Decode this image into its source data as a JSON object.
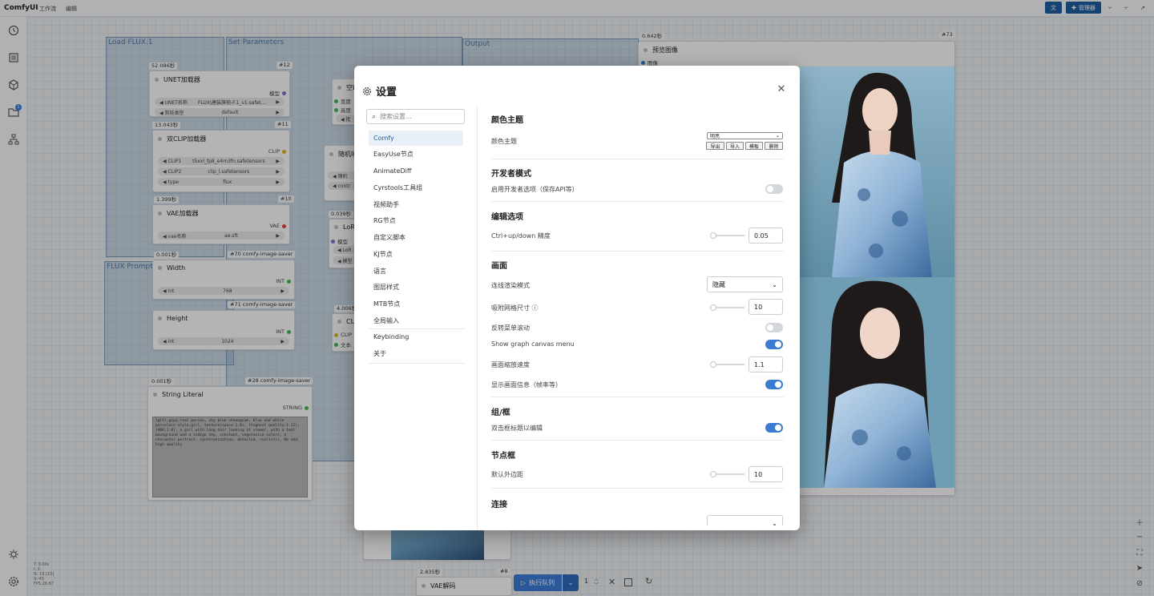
{
  "app": {
    "title": "ComfyUI",
    "menus": [
      "工作流",
      "编辑"
    ]
  },
  "topbar": {
    "translate_icon": "translate-icon",
    "manager_label": "管理器"
  },
  "sidebar": {
    "badge_count": "1"
  },
  "stats": [
    "T: 0.00s",
    "I: 0",
    "N: 10 [10]",
    "V: 43",
    "FPS:26.67"
  ],
  "groups": [
    "Load FLUX.1",
    "Set Parameters",
    "Output",
    "FLUX Prompt"
  ],
  "nodes": {
    "unet": {
      "time": "52.086秒",
      "id": "#12",
      "title": "UNET加载器",
      "out": "模型",
      "w1_label": "UNET名称",
      "w1_value": "FLUX\\唐装旗袍-F.1_v1.safet...",
      "w2_label": "剪枝类型",
      "w2_value": "default"
    },
    "clip": {
      "time": "13.043秒",
      "id": "#11",
      "title": "双CLIP加载器",
      "out": "CLIP",
      "w1_label": "CLIP1",
      "w1_value": "t5xxl_fp8_e4m3fn.safetensors",
      "w2_label": "CLIP2",
      "w2_value": "clip_l.safetensors",
      "w3_label": "type",
      "w3_value": "flux"
    },
    "vae": {
      "time": "1.399秒",
      "id": "#10",
      "title": "VAE加载器",
      "out": "VAE",
      "w1_label": "vae名称",
      "w1_value": "ae.sft"
    },
    "width": {
      "time": "0.001秒",
      "id": "#70 comfy-image-saver",
      "title": "Width",
      "out": "INT",
      "w1_label": "int",
      "w1_value": "768"
    },
    "height": {
      "id": "#71 comfy-image-saver",
      "title": "Height",
      "out": "INT",
      "w1_label": "int",
      "w1_value": "1024"
    },
    "string": {
      "time": "0.001秒",
      "id": "#28 comfy-image-saver",
      "title": "String Literal",
      "out": "STRING",
      "text": "lgltl,gipa,real person, sky blue cheongsam, blue and white porcelain style,girl, texture(space:1.0), (highest quality:1.12), (HDR:1.0), a girl with long hair looking at viewer, with a teal background and a indigo sky, constant, vegetasive colors, a character portrait, synchronization, detailed, realistic, 8k uhd, high quality"
    },
    "empty_latent": {
      "title": "空L",
      "p1": "宽度",
      "p2": "高度",
      "w": "批"
    },
    "noise": {
      "title": "随机噪",
      "w1": "随机",
      "w2": "contr"
    },
    "lora": {
      "time": "0.039秒",
      "title": "LoRA",
      "p1": "模型",
      "w1": "LoR",
      "w2": "模型"
    },
    "cliptext": {
      "time": "4.006秒",
      "title": "CL",
      "p1": "CLIP",
      "p2": "文本"
    },
    "preview": {
      "time": "0.642秒",
      "id": "#73",
      "title": "预览图像",
      "in": "图像"
    },
    "vaedecode": {
      "time": "2.835秒",
      "id": "#8",
      "title": "VAE解码"
    }
  },
  "dialog": {
    "title": "设置",
    "search_placeholder": "搜索设置...",
    "categories": [
      "Comfy",
      "EasyUse节点",
      "AnimateDiff",
      "Cyrstools工具组",
      "视频助手",
      "RG节点",
      "自定义脚本",
      "KJ节点",
      "语言",
      "图层样式",
      "MTB节点",
      "全局输入",
      "Keybinding",
      "关于"
    ],
    "sections": {
      "color_theme": {
        "title": "颜色主题",
        "label": "颜色主题",
        "select_value": "明亮",
        "buttons": [
          "导出",
          "导入",
          "模板",
          "删除"
        ]
      },
      "dev_mode": {
        "title": "开发者模式",
        "label": "启用开发者选项（保存API等）"
      },
      "edit": {
        "title": "编辑选项",
        "label": "Ctrl+up/down 精度",
        "value": "0.05"
      },
      "canvas": {
        "title": "画面",
        "link_render_label": "连线渲染模式",
        "link_render_value": "隐藏",
        "snap_label": "吸附网格尺寸",
        "snap_value": "10",
        "invert_scroll_label": "反转菜单滚动",
        "graph_menu_label": "Show graph canvas menu",
        "zoom_speed_label": "画面缩放速度",
        "zoom_speed_value": "1.1",
        "show_info_label": "显示画面信息（帧率等）"
      },
      "group": {
        "title": "组/框",
        "label": "双击框标题以编辑"
      },
      "node_box": {
        "title": "节点框",
        "label": "默认外边距",
        "value": "10"
      },
      "link": {
        "title": "连接"
      }
    }
  },
  "queue": {
    "run_label": "执行队列",
    "count": "1"
  }
}
